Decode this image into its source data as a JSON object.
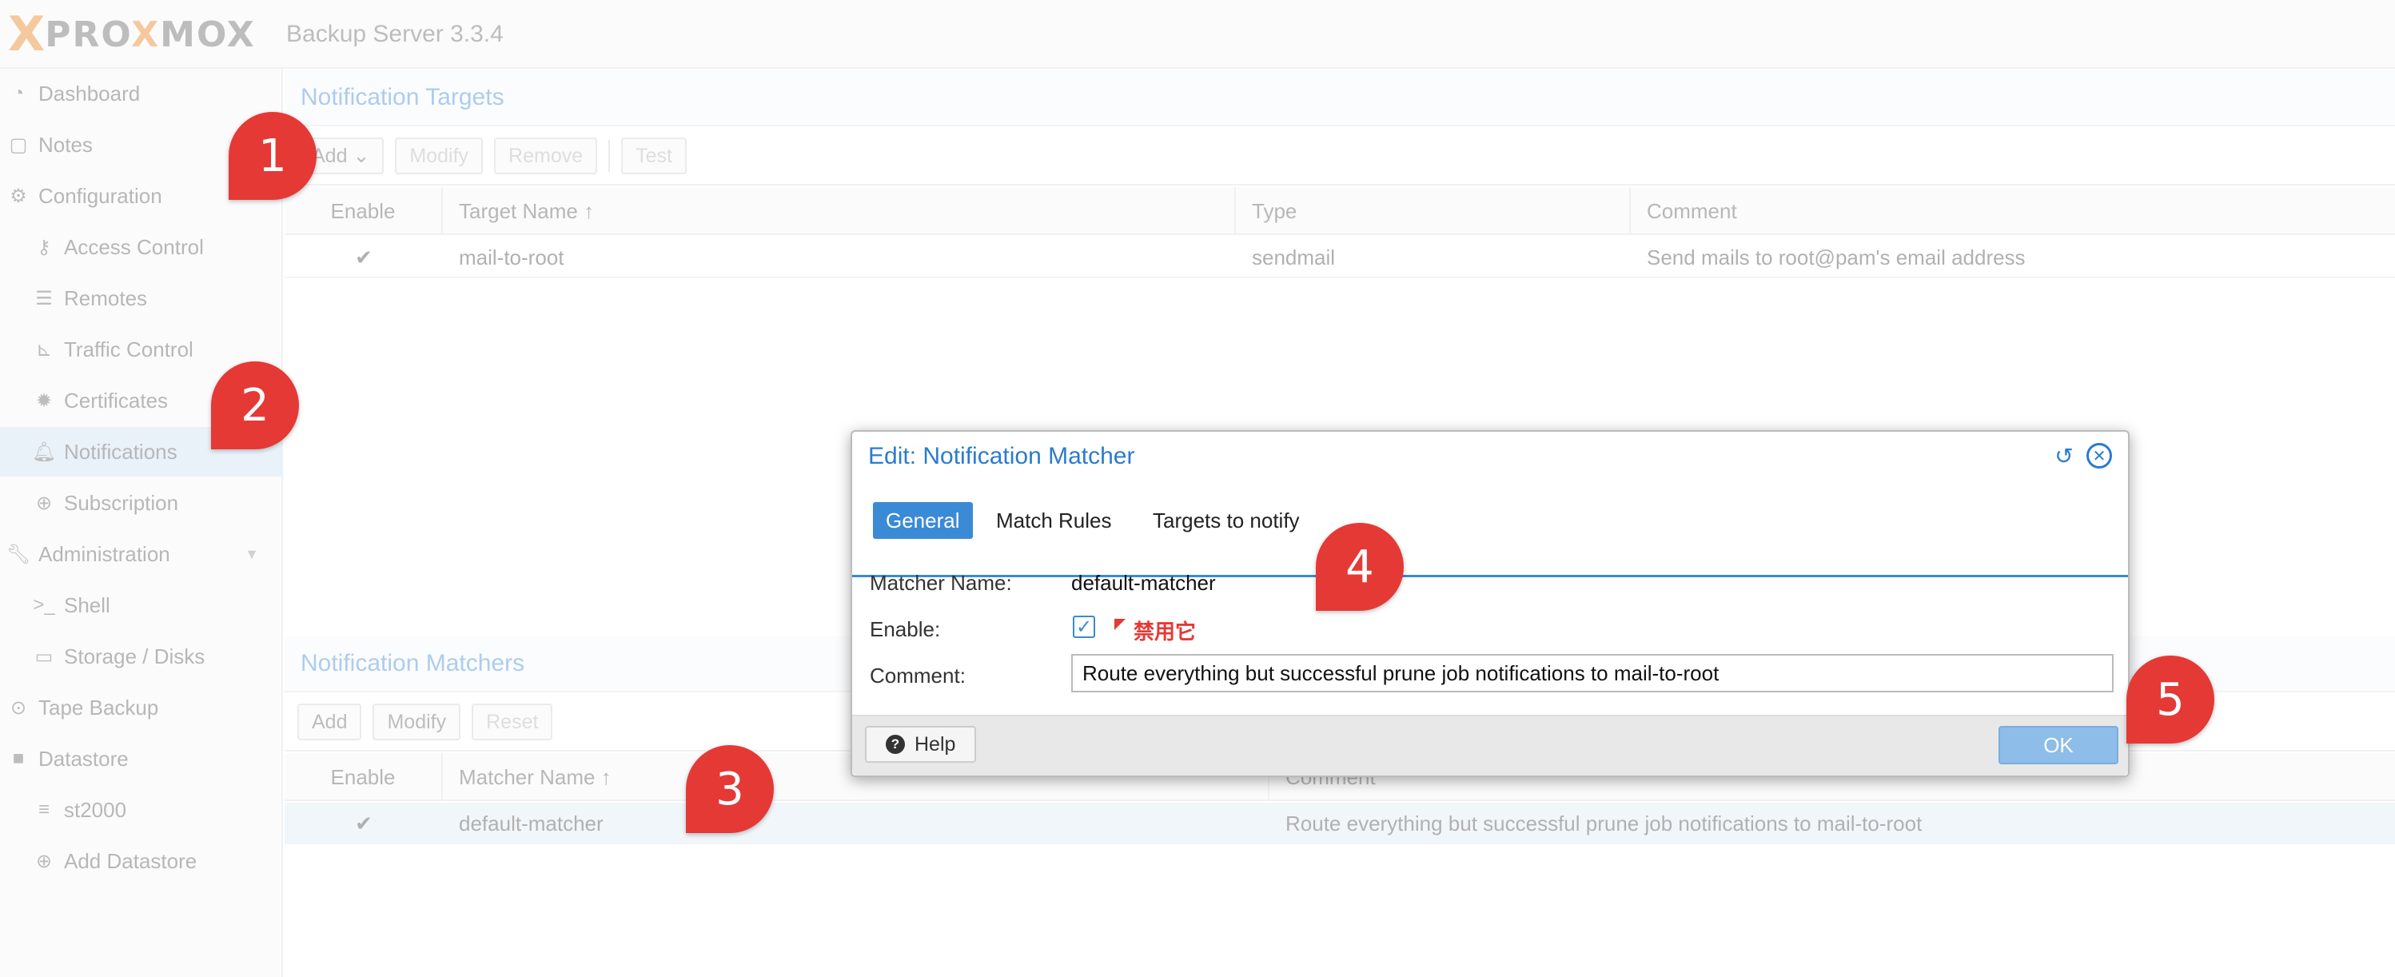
{
  "header": {
    "logo_x": "X",
    "logo_text_pre": "PRO",
    "logo_text_o": "X",
    "logo_text_post": "MOX",
    "product": "Backup Server 3.3.4"
  },
  "sidebar": {
    "items": [
      {
        "label": "Dashboard",
        "icon": "dashboard-icon"
      },
      {
        "label": "Notes",
        "icon": "notes-icon"
      },
      {
        "label": "Configuration",
        "icon": "gears-icon"
      },
      {
        "label": "Access Control",
        "icon": "key-icon"
      },
      {
        "label": "Remotes",
        "icon": "server-icon"
      },
      {
        "label": "Traffic Control",
        "icon": "chart-icon"
      },
      {
        "label": "Certificates",
        "icon": "certificate-icon"
      },
      {
        "label": "Notifications",
        "icon": "bell-icon"
      },
      {
        "label": "Subscription",
        "icon": "support-icon"
      },
      {
        "label": "Administration",
        "icon": "wrench-icon"
      },
      {
        "label": "Shell",
        "icon": "terminal-icon"
      },
      {
        "label": "Storage / Disks",
        "icon": "hdd-icon"
      },
      {
        "label": "Tape Backup",
        "icon": "tape-icon"
      },
      {
        "label": "Datastore",
        "icon": "archive-icon"
      },
      {
        "label": "st2000",
        "icon": "database-icon"
      },
      {
        "label": "Add Datastore",
        "icon": "plus-circle-icon"
      }
    ]
  },
  "targets": {
    "title": "Notification Targets",
    "toolbar": {
      "add": "Add",
      "modify": "Modify",
      "remove": "Remove",
      "test": "Test"
    },
    "columns": {
      "enable": "Enable",
      "name": "Target Name ↑",
      "type": "Type",
      "comment": "Comment"
    },
    "rows": [
      {
        "enable": "✔",
        "name": "mail-to-root",
        "type": "sendmail",
        "comment": "Send mails to root@pam's email address"
      }
    ]
  },
  "matchers": {
    "title": "Notification Matchers",
    "toolbar": {
      "add": "Add",
      "modify": "Modify",
      "reset": "Reset"
    },
    "columns": {
      "enable": "Enable",
      "name": "Matcher Name ↑",
      "comment": "Comment"
    },
    "rows": [
      {
        "enable": "✔",
        "name": "default-matcher",
        "comment": "Route everything but successful prune job notifications to mail-to-root"
      }
    ]
  },
  "modal": {
    "title": "Edit: Notification Matcher",
    "tabs": [
      "General",
      "Match Rules",
      "Targets to notify"
    ],
    "fields": {
      "name_label": "Matcher Name:",
      "name_value": "default-matcher",
      "enable_label": "Enable:",
      "enable_checked": "✓",
      "annotation": "禁用它",
      "comment_label": "Comment:",
      "comment_value": "Route everything but successful prune job notifications to mail-to-root"
    },
    "help": "Help",
    "ok": "OK"
  },
  "markers": [
    "1",
    "2",
    "3",
    "4",
    "5"
  ],
  "colors": {
    "accent": "#3a8ad6",
    "brand": "#e57000",
    "marker": "#e53935"
  }
}
